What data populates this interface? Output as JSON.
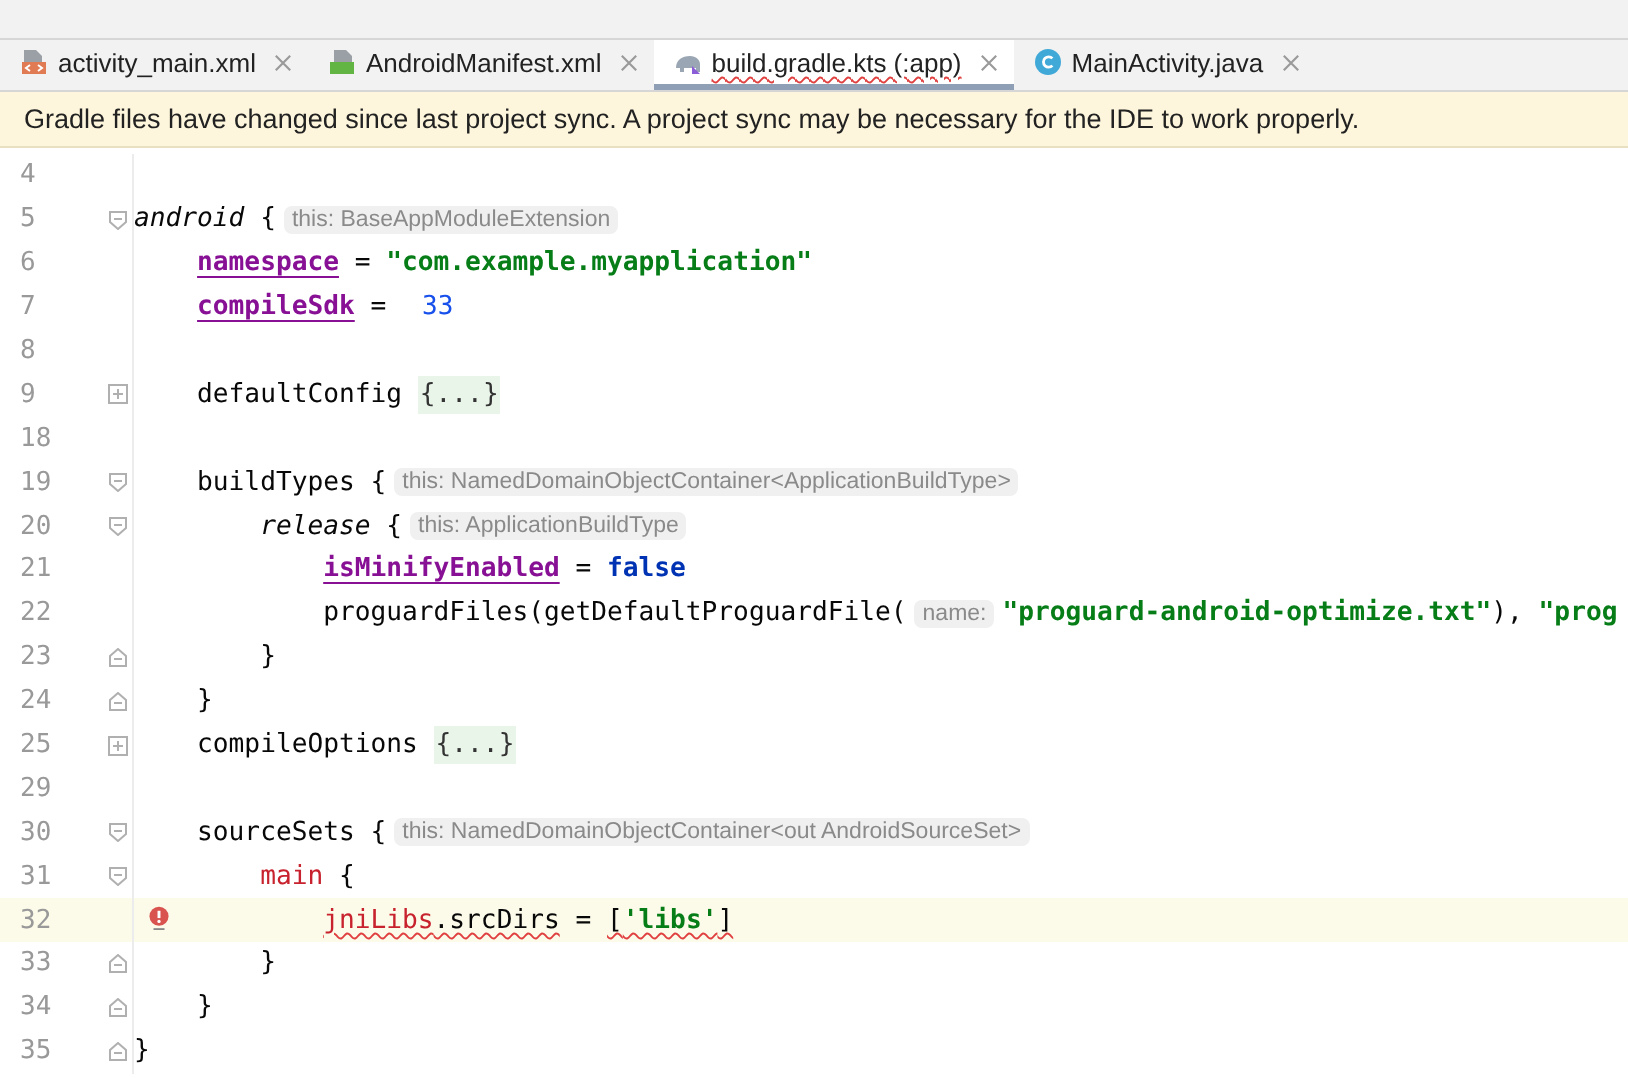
{
  "tabs": [
    {
      "label": "activity_main.xml",
      "selected": false,
      "error": false
    },
    {
      "label": "AndroidManifest.xml",
      "selected": false,
      "error": false
    },
    {
      "label": "build.gradle.kts (:app)",
      "selected": true,
      "error": true
    },
    {
      "label": "MainActivity.java",
      "selected": false,
      "error": false
    }
  ],
  "banner": {
    "text": "Gradle files have changed since last project sync. A project sync may be necessary for the IDE to work properly."
  },
  "editor": {
    "lines": [
      {
        "number": "4"
      },
      {
        "number": "5",
        "kind": "fold-start",
        "tokens": [
          {
            "kind": "italic",
            "text": "android"
          },
          {
            "kind": "text",
            "text": " {"
          },
          {
            "kind": "hint",
            "text": "this: BaseAppModuleExtension"
          }
        ],
        "children": [
          {
            "number": "6",
            "tokens": [
              {
                "kind": "property",
                "text": "namespace"
              },
              {
                "kind": "text",
                "text": " = "
              },
              {
                "kind": "string",
                "text": "\"com.example.myapplication\""
              }
            ]
          },
          {
            "number": "7",
            "tokens": [
              {
                "kind": "property",
                "text": "compileSdk"
              },
              {
                "kind": "text",
                "text": " = "
              },
              {
                "kind": "number",
                "text": "33"
              }
            ]
          },
          {
            "number": "8"
          },
          {
            "number": "9",
            "kind": "collapsed",
            "tokens": [
              {
                "kind": "text",
                "text": "defaultConfig "
              },
              {
                "kind": "folded",
                "text": "{...}"
              }
            ]
          },
          {
            "number": "18"
          },
          {
            "number": "19",
            "kind": "fold-start",
            "tokens": [
              {
                "kind": "text",
                "text": "buildTypes {"
              },
              {
                "kind": "hint",
                "text": "this: NamedDomainObjectContainer<ApplicationBuildType>"
              }
            ],
            "children": [
              {
                "number": "20",
                "kind": "fold-start",
                "tokens": [
                  {
                    "kind": "italic",
                    "text": "release"
                  },
                  {
                    "kind": "text",
                    "text": " {"
                  },
                  {
                    "kind": "hint",
                    "text": "this: ApplicationBuildType"
                  }
                ],
                "children": [
                  {
                    "number": "21",
                    "tokens": [
                      {
                        "kind": "property",
                        "text": "isMinifyEnabled"
                      },
                      {
                        "kind": "text",
                        "text": " = "
                      },
                      {
                        "kind": "keyword",
                        "text": "false"
                      }
                    ]
                  },
                  {
                    "number": "22",
                    "tokens": [
                      {
                        "kind": "text",
                        "text": "proguardFiles(getDefaultProguardFile("
                      },
                      {
                        "kind": "hint",
                        "text": "name:"
                      },
                      {
                        "kind": "string",
                        "text": "\"proguard-android-optimize.txt\""
                      },
                      {
                        "kind": "text",
                        "text": "), "
                      },
                      {
                        "kind": "string",
                        "text": "\"prog"
                      }
                    ]
                  }
                ]
              },
              {
                "number": "23",
                "kind": "fold-end",
                "tokens": [
                  {
                    "kind": "text",
                    "text": "}"
                  }
                ]
              }
            ]
          },
          {
            "number": "24",
            "kind": "fold-end",
            "tokens": [
              {
                "kind": "text",
                "text": "}"
              }
            ]
          },
          {
            "number": "25",
            "kind": "collapsed",
            "tokens": [
              {
                "kind": "text",
                "text": "compileOptions "
              },
              {
                "kind": "folded",
                "text": "{...}"
              }
            ]
          },
          {
            "number": "29"
          },
          {
            "number": "30",
            "kind": "fold-start",
            "tokens": [
              {
                "kind": "text",
                "text": "sourceSets {"
              },
              {
                "kind": "hint",
                "text": "this: NamedDomainObjectContainer<out AndroidSourceSet>"
              }
            ],
            "children": [
              {
                "number": "31",
                "kind": "fold-start",
                "tokens": [
                  {
                    "kind": "unresolved",
                    "text": "main"
                  },
                  {
                    "kind": "text",
                    "text": " {"
                  }
                ],
                "children": [
                  {
                    "number": "32",
                    "current": true,
                    "error": true,
                    "tokens": [
                      {
                        "kind": "unresolved-wavy",
                        "text": "jniLibs"
                      },
                      {
                        "kind": "wavy",
                        "text": ".srcDirs"
                      },
                      {
                        "kind": "text",
                        "text": " = "
                      },
                      {
                        "kind": "wavy",
                        "text": "["
                      },
                      {
                        "kind": "string-wavy",
                        "text": "'libs'"
                      },
                      {
                        "kind": "wavy",
                        "text": "]"
                      }
                    ]
                  }
                ]
              },
              {
                "number": "33",
                "kind": "fold-end",
                "tokens": [
                  {
                    "kind": "text",
                    "text": "}"
                  }
                ]
              }
            ]
          },
          {
            "number": "34",
            "kind": "fold-end",
            "tokens": [
              {
                "kind": "text",
                "text": "}"
              }
            ]
          }
        ]
      },
      {
        "number": "35",
        "kind": "fold-end",
        "tokens": [
          {
            "kind": "text",
            "text": "}"
          }
        ]
      }
    ]
  }
}
